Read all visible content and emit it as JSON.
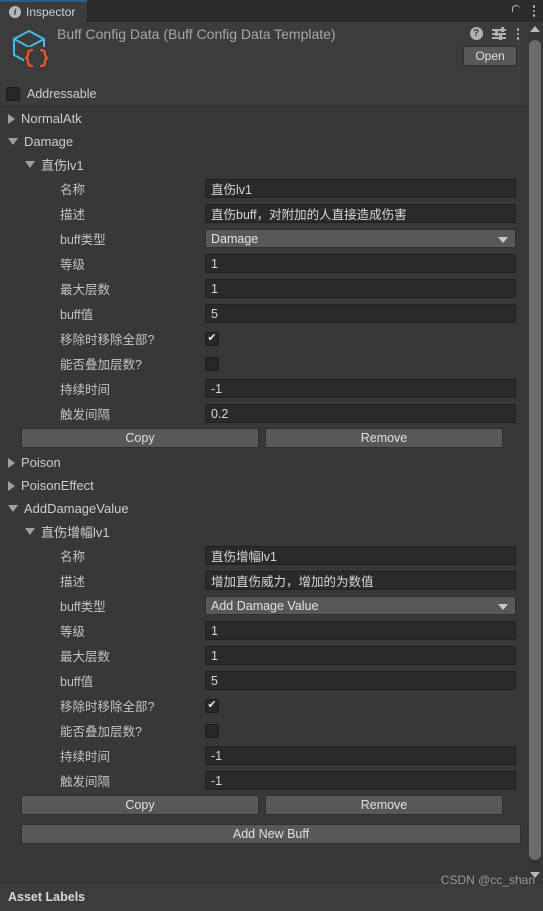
{
  "window": {
    "tab_label": "Inspector",
    "tab_icon": "info-icon",
    "lock_icon": "lock-icon",
    "menu_icon": "kebab-menu-icon"
  },
  "asset_header": {
    "title": "Buff Config Data (Buff Config Data Template)",
    "icon": "scriptable-object-icon",
    "help_icon": "help-icon",
    "preset_icon": "preset-icon",
    "menu_icon": "kebab-menu-icon",
    "open_label": "Open"
  },
  "addressable": {
    "label": "Addressable",
    "checked": false
  },
  "groups": [
    {
      "name": "NormalAtk",
      "expanded": false,
      "buffs": []
    },
    {
      "name": "Damage",
      "expanded": true,
      "buffs": [
        {
          "name": "直伤lv1",
          "expanded": true,
          "fields": [
            {
              "label": "名称",
              "type": "text",
              "value": "直伤lv1"
            },
            {
              "label": "描述",
              "type": "text",
              "value": "直伤buff，对附加的人直接造成伤害"
            },
            {
              "label": "buff类型",
              "type": "dropdown",
              "value": "Damage"
            },
            {
              "label": "等级",
              "type": "text",
              "value": "1"
            },
            {
              "label": "最大层数",
              "type": "text",
              "value": "1"
            },
            {
              "label": "buff值",
              "type": "text",
              "value": "5"
            },
            {
              "label": "移除时移除全部?",
              "type": "checkbox",
              "value": true
            },
            {
              "label": "能否叠加层数?",
              "type": "checkbox",
              "value": false
            },
            {
              "label": "持续时间",
              "type": "text",
              "value": "-1"
            },
            {
              "label": "触发间隔",
              "type": "text",
              "value": "0.2"
            }
          ],
          "copy_label": "Copy",
          "remove_label": "Remove"
        }
      ]
    },
    {
      "name": "Poison",
      "expanded": false,
      "buffs": []
    },
    {
      "name": "PoisonEffect",
      "expanded": false,
      "buffs": []
    },
    {
      "name": "AddDamageValue",
      "expanded": true,
      "buffs": [
        {
          "name": "直伤增幅lv1",
          "expanded": true,
          "fields": [
            {
              "label": "名称",
              "type": "text",
              "value": "直伤增幅lv1"
            },
            {
              "label": "描述",
              "type": "text",
              "value": "增加直伤威力，增加的为数值"
            },
            {
              "label": "buff类型",
              "type": "dropdown",
              "value": "Add Damage Value"
            },
            {
              "label": "等级",
              "type": "text",
              "value": "1"
            },
            {
              "label": "最大层数",
              "type": "text",
              "value": "1"
            },
            {
              "label": "buff值",
              "type": "text",
              "value": "5"
            },
            {
              "label": "移除时移除全部?",
              "type": "checkbox",
              "value": true
            },
            {
              "label": "能否叠加层数?",
              "type": "checkbox",
              "value": false
            },
            {
              "label": "持续时间",
              "type": "text",
              "value": "-1"
            },
            {
              "label": "触发间隔",
              "type": "text",
              "value": "-1"
            }
          ],
          "copy_label": "Copy",
          "remove_label": "Remove"
        }
      ]
    }
  ],
  "add_new_buff_label": "Add New Buff",
  "bottom": {
    "asset_labels": "Asset Labels",
    "watermark": "CSDN @cc_shan"
  },
  "colors": {
    "window_bg": "#383838",
    "panel_bg": "#3c3c3c",
    "tabstrip_bg": "#2b2b2b",
    "field_bg": "#2a2a2a",
    "button_bg": "#585858",
    "accent": "#2c5d87",
    "text": "#cfcfcf",
    "icon_cube": "#49b8e8",
    "icon_braces": "#f1542a"
  }
}
